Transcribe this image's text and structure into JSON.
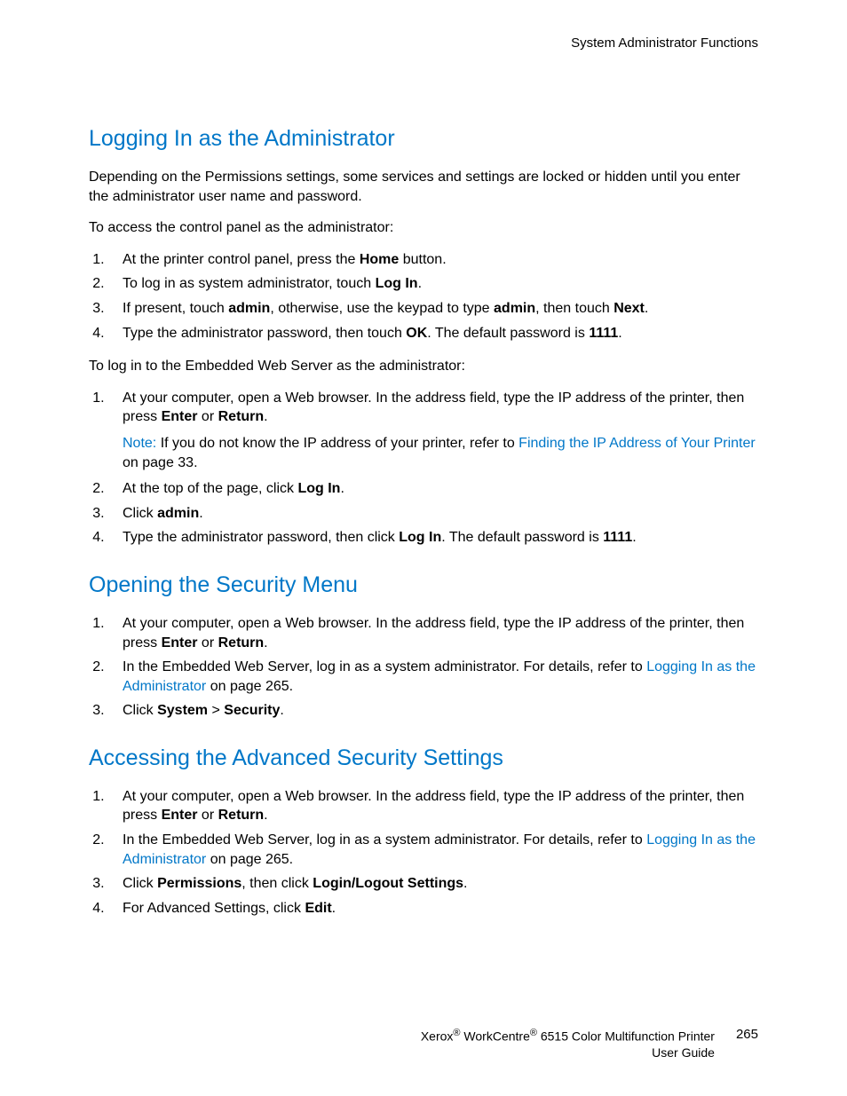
{
  "header": "System Administrator Functions",
  "section1": {
    "heading": "Logging In as the Administrator",
    "intro": "Depending on the Permissions settings, some services and settings are locked or hidden until you enter the administrator user name and password.",
    "sub_a_lead": "To access the control panel as the administrator:",
    "a1_pre": "At the printer control panel, press the ",
    "a1_bold": "Home",
    "a1_post": " button.",
    "a2_pre": "To log in as system administrator, touch ",
    "a2_bold": "Log In",
    "a2_post": ".",
    "a3_pre": "If present, touch ",
    "a3_b1": "admin",
    "a3_mid": ", otherwise, use the keypad to type ",
    "a3_b2": "admin",
    "a3_mid2": ", then touch ",
    "a3_b3": "Next",
    "a3_post": ".",
    "a4_pre": "Type the administrator password, then touch ",
    "a4_b1": "OK",
    "a4_mid": ". The default password is ",
    "a4_b2": "1111",
    "a4_post": ".",
    "sub_b_lead": "To log in to the Embedded Web Server as the administrator:",
    "b1_pre": "At your computer, open a Web browser. In the address field, type the IP address of the printer, then press ",
    "b1_b1": "Enter",
    "b1_mid": " or ",
    "b1_b2": "Return",
    "b1_post": ".",
    "note_label": "Note: ",
    "note_text_pre": "If you do not know the IP address of your printer, refer to ",
    "note_link": "Finding the IP Address of Your Printer",
    "note_text_post": " on page 33.",
    "b2_pre": "At the top of the page, click ",
    "b2_b1": "Log In",
    "b2_post": ".",
    "b3_pre": "Click ",
    "b3_b1": "admin",
    "b3_post": ".",
    "b4_pre": "Type the administrator password, then click ",
    "b4_b1": "Log In",
    "b4_mid": ". The default password is ",
    "b4_b2": "1111",
    "b4_post": "."
  },
  "section2": {
    "heading": "Opening the Security Menu",
    "s1_pre": "At your computer, open a Web browser. In the address field, type the IP address of the printer, then press ",
    "s1_b1": "Enter",
    "s1_mid": " or ",
    "s1_b2": "Return",
    "s1_post": ".",
    "s2_pre": "In the Embedded Web Server, log in as a system administrator. For details, refer to ",
    "s2_link": "Logging In as the Administrator",
    "s2_post": " on page 265.",
    "s3_pre": "Click ",
    "s3_b1": "System",
    "s3_mid": " > ",
    "s3_b2": "Security",
    "s3_post": "."
  },
  "section3": {
    "heading": "Accessing the Advanced Security Settings",
    "s1_pre": "At your computer, open a Web browser. In the address field, type the IP address of the printer, then press ",
    "s1_b1": "Enter",
    "s1_mid": " or ",
    "s1_b2": "Return",
    "s1_post": ".",
    "s2_pre": "In the Embedded Web Server, log in as a system administrator. For details, refer to ",
    "s2_link": "Logging In as the Administrator",
    "s2_post": " on page 265.",
    "s3_pre": "Click ",
    "s3_b1": "Permissions",
    "s3_mid": ", then click ",
    "s3_b2": "Login/Logout Settings",
    "s3_post": ".",
    "s4_pre": "For Advanced Settings, click ",
    "s4_b1": "Edit",
    "s4_post": "."
  },
  "footer": {
    "brand1": "Xerox",
    "brand2": "WorkCentre",
    "product": "6515 Color Multifunction Printer",
    "subtitle": "User Guide",
    "page": "265"
  }
}
